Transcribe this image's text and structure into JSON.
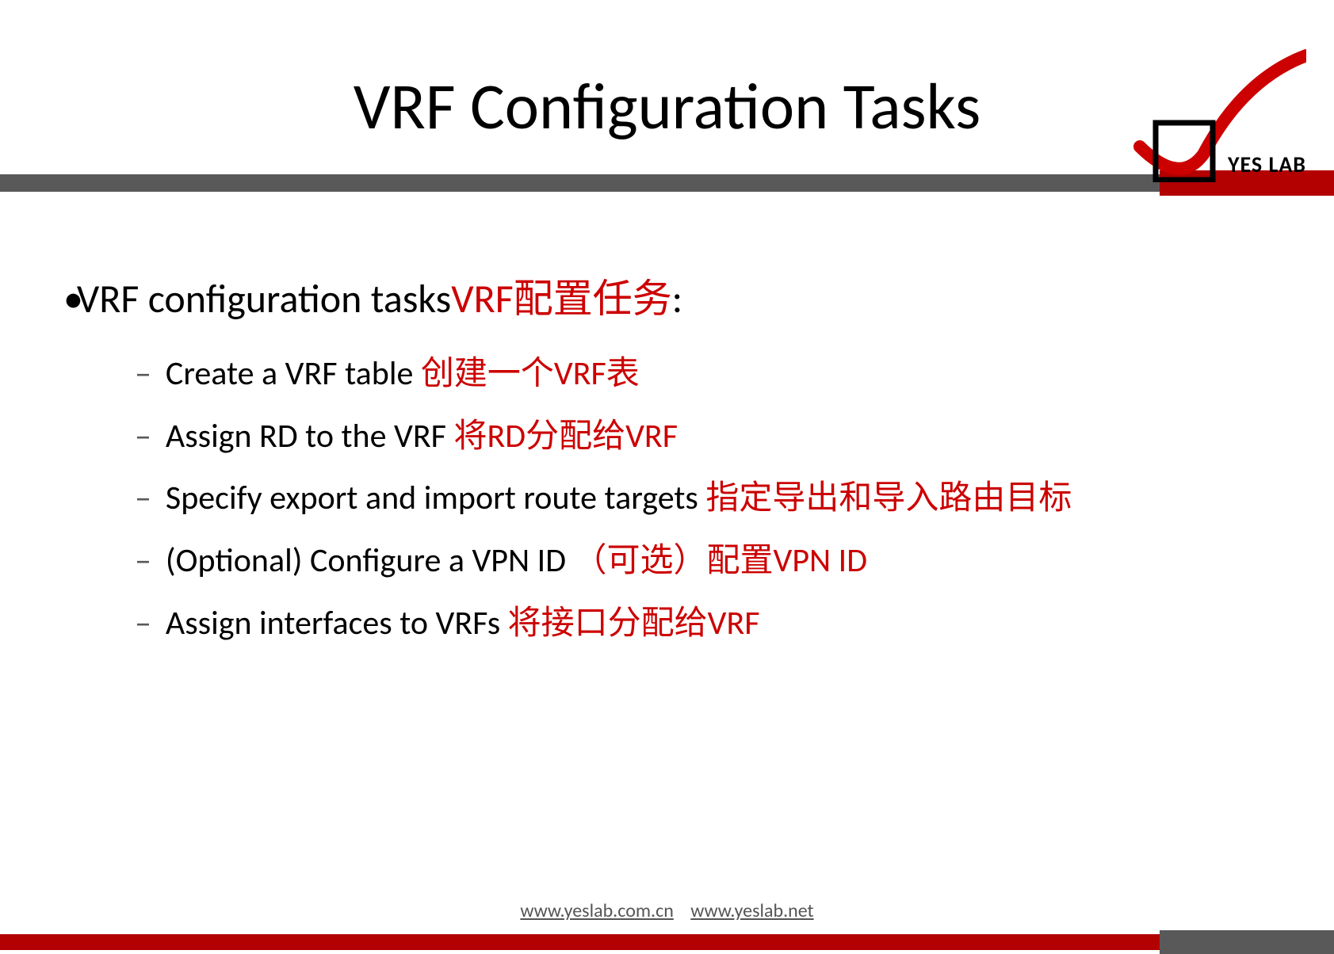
{
  "slide": {
    "title": "VRF Configuration Tasks",
    "logo": {
      "text": "YES LAB"
    },
    "mainBullet": {
      "englishPart": "VRF configuration tasks",
      "redPart": "VRF配置任务",
      "colon": ":"
    },
    "subBullets": [
      {
        "english": "Create a VRF table ",
        "red": "创建一个VRF表"
      },
      {
        "english": "Assign RD to the VRF ",
        "red": "将RD分配给VRF"
      },
      {
        "english": "Specify export and import route targets ",
        "red": "指定导出和导入路由目标"
      },
      {
        "english": "(Optional) Configure a VPN ID ",
        "red": "（可选）配置VPN ID"
      },
      {
        "english": "Assign interfaces to VRFs ",
        "red": "将接口分配给VRF"
      }
    ],
    "footer": {
      "link1": "www.yeslab.com.cn",
      "link2": "www.yeslab.net"
    }
  }
}
